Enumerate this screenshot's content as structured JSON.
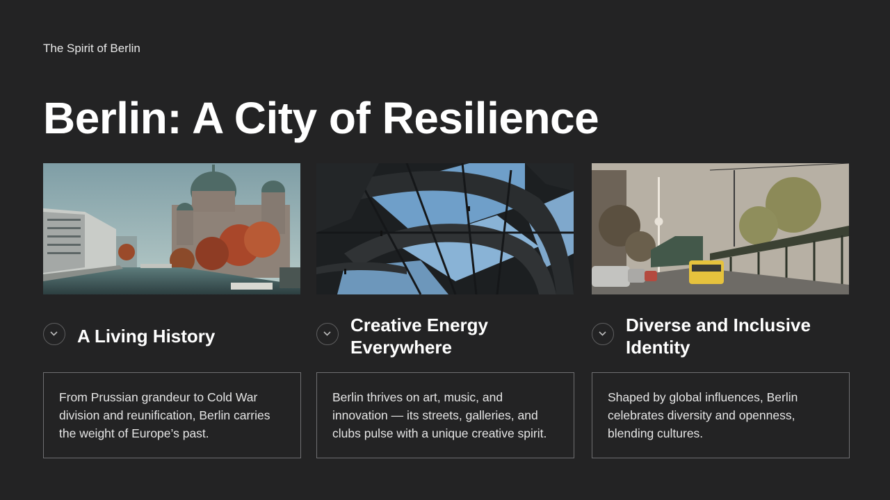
{
  "slide": {
    "kicker": "The Spirit of Berlin",
    "title": "Berlin: A City of Resilience"
  },
  "cards": [
    {
      "title": "A Living History",
      "body": "From Prussian grandeur to Cold War division and reunification, Berlin carries the weight of Europe’s past.",
      "icon": "chevron-down-icon"
    },
    {
      "title": "Creative Energy Everywhere",
      "body": "Berlin thrives on art, music, and innovation — its streets, galleries, and clubs pulse with a unique creative spirit.",
      "icon": "chevron-down-icon"
    },
    {
      "title": "Diverse and Inclusive Identity",
      "body": "Shaped by global influences, Berlin celebrates diversity and openness, blending cultures.",
      "icon": "chevron-down-icon"
    }
  ],
  "colors": {
    "background": "#232324",
    "text": "#ffffff",
    "border": "#707072"
  }
}
